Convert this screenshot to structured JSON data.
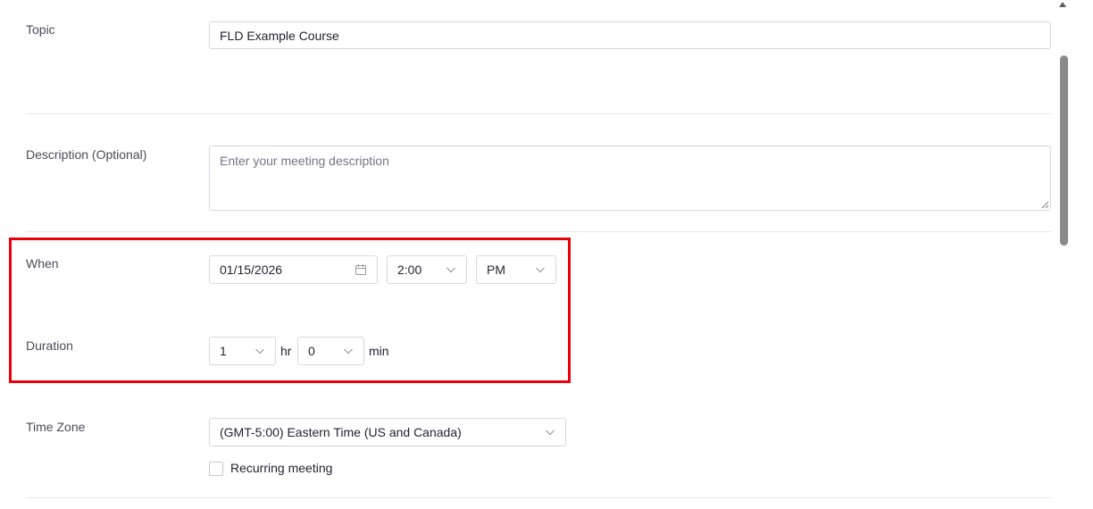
{
  "form": {
    "topic": {
      "label": "Topic",
      "value": "FLD Example Course"
    },
    "description": {
      "label": "Description (Optional)",
      "placeholder": "Enter your meeting description"
    },
    "when": {
      "label": "When",
      "date": "01/15/2026",
      "time": "2:00",
      "ampm": "PM"
    },
    "duration": {
      "label": "Duration",
      "hours": "1",
      "hours_unit": "hr",
      "minutes": "0",
      "minutes_unit": "min"
    },
    "timezone": {
      "label": "Time Zone",
      "value": "(GMT-5:00) Eastern Time (US and Canada)"
    },
    "recurring": {
      "label": "Recurring meeting",
      "checked": false
    }
  },
  "highlight_color": "#e8000b",
  "icons": {
    "calendar": "calendar-icon",
    "chevron": "chevron-down-icon"
  }
}
